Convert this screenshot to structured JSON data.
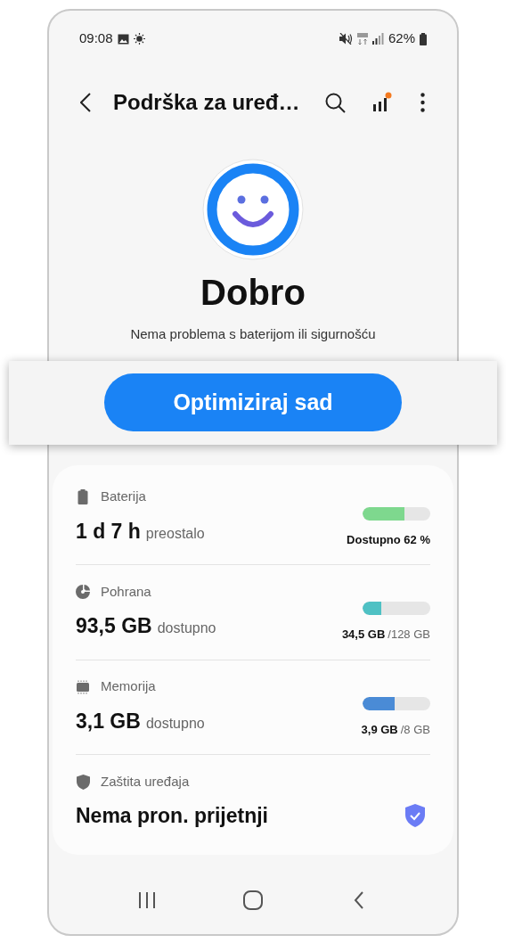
{
  "status_bar": {
    "time": "09:08",
    "battery_percent": "62%"
  },
  "header": {
    "title": "Podrška za uređ…"
  },
  "status": {
    "title": "Dobro",
    "subtitle": "Nema problema s baterijom ili sigurnošću"
  },
  "primary_button": {
    "label": "Optimiziraj sad"
  },
  "items": [
    {
      "kind": "battery",
      "label": "Baterija",
      "value": "1 d 7 h",
      "unit": "preostalo",
      "level": 0.62,
      "color": "#7ed88e",
      "detail": "Dostupno 62 %"
    },
    {
      "kind": "storage",
      "label": "Pohrana",
      "value": "93,5 GB",
      "unit": "dostupno",
      "level": 0.27,
      "color": "#4fc1c4",
      "detail": "34,5 GB",
      "detail_total": "/128 GB"
    },
    {
      "kind": "memory",
      "label": "Memorija",
      "value": "3,1 GB",
      "unit": "dostupno",
      "level": 0.48,
      "color": "#4a8bd6",
      "detail": "3,9 GB",
      "detail_total": "/8 GB"
    },
    {
      "kind": "protection",
      "label": "Zaštita uređaja",
      "value": "Nema pron. prijetnji"
    }
  ]
}
